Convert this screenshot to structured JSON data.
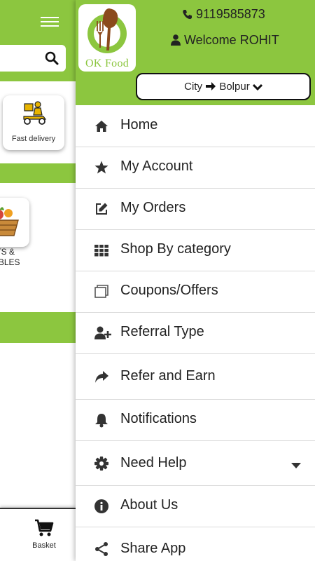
{
  "background_app": {
    "search": {
      "placeholder": ""
    },
    "fast_delivery_label": "Fast delivery",
    "category_label": "ITS &\nTABLES",
    "basket_label": "Basket"
  },
  "drawer": {
    "logo_text": "OK Food",
    "phone": "9119585873",
    "welcome": "Welcome ROHIT",
    "city_label": "City",
    "city_value": "Bolpur",
    "menu": [
      {
        "label": "Home",
        "icon": "home-icon"
      },
      {
        "label": "My Account",
        "icon": "star-icon"
      },
      {
        "label": "My Orders",
        "icon": "edit-icon"
      },
      {
        "label": "Shop By category",
        "icon": "grid-icon"
      },
      {
        "label": "Coupons/Offers",
        "icon": "clone-icon"
      },
      {
        "label": "Referral Type",
        "icon": "user-plus-icon"
      },
      {
        "label": "Refer and Earn",
        "icon": "share-arrow-icon"
      },
      {
        "label": "Notifications",
        "icon": "bell-icon"
      },
      {
        "label": "Need Help",
        "icon": "gear-icon",
        "expandable": true
      },
      {
        "label": "About Us",
        "icon": "info-icon"
      },
      {
        "label": "Share App",
        "icon": "share-icon"
      }
    ]
  },
  "colors": {
    "brand_green": "#8cc63f",
    "text": "#222222",
    "divider": "#d9d9d9",
    "logo_brown": "#8b4a1c"
  }
}
